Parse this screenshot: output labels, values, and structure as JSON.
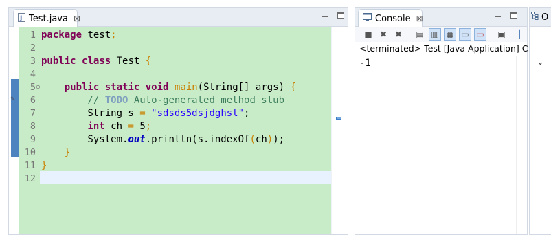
{
  "editor": {
    "tab": {
      "label": "Test.java",
      "close": "⊠"
    },
    "lines": [
      {
        "num": "1",
        "tokens": [
          {
            "t": "package",
            "c": "kw"
          },
          {
            "t": " test",
            "c": ""
          },
          {
            "t": ";",
            "c": "brk"
          }
        ]
      },
      {
        "num": "2",
        "tokens": []
      },
      {
        "num": "3",
        "tokens": [
          {
            "t": "public",
            "c": "kw"
          },
          {
            "t": " ",
            "c": ""
          },
          {
            "t": "class",
            "c": "kw"
          },
          {
            "t": " Test ",
            "c": ""
          },
          {
            "t": "{",
            "c": "brk"
          }
        ]
      },
      {
        "num": "4",
        "tokens": []
      },
      {
        "num": "5",
        "fold": "⊖",
        "tokens": [
          {
            "t": "    ",
            "c": ""
          },
          {
            "t": "public",
            "c": "kw"
          },
          {
            "t": " ",
            "c": ""
          },
          {
            "t": "static",
            "c": "kw"
          },
          {
            "t": " ",
            "c": ""
          },
          {
            "t": "void",
            "c": "kw"
          },
          {
            "t": " ",
            "c": ""
          },
          {
            "t": "main",
            "c": "brk"
          },
          {
            "t": "(String[] args) ",
            "c": ""
          },
          {
            "t": "{",
            "c": "brk"
          }
        ]
      },
      {
        "num": "6",
        "tokens": [
          {
            "t": "        // ",
            "c": "cmt"
          },
          {
            "t": "TODO",
            "c": "todo"
          },
          {
            "t": " Auto-generated method stub",
            "c": "cmt"
          }
        ]
      },
      {
        "num": "7",
        "tokens": [
          {
            "t": "        String s ",
            "c": ""
          },
          {
            "t": "=",
            "c": "brk"
          },
          {
            "t": " ",
            "c": ""
          },
          {
            "t": "\"sdsds5dsjdghsl\"",
            "c": "str"
          },
          {
            "t": ";",
            "c": ""
          }
        ]
      },
      {
        "num": "8",
        "tokens": [
          {
            "t": "        ",
            "c": ""
          },
          {
            "t": "int",
            "c": "kw"
          },
          {
            "t": " ch ",
            "c": ""
          },
          {
            "t": "=",
            "c": "brk"
          },
          {
            "t": " 5",
            "c": ""
          },
          {
            "t": ";",
            "c": "brk"
          }
        ]
      },
      {
        "num": "9",
        "tokens": [
          {
            "t": "        System.",
            "c": ""
          },
          {
            "t": "out",
            "c": "fld"
          },
          {
            "t": ".println(s.indexOf",
            "c": ""
          },
          {
            "t": "(",
            "c": "brk"
          },
          {
            "t": "ch",
            "c": ""
          },
          {
            "t": ")",
            "c": "brk"
          },
          {
            "t": ");",
            "c": ""
          }
        ]
      },
      {
        "num": "10",
        "tokens": [
          {
            "t": "    ",
            "c": ""
          },
          {
            "t": "}",
            "c": "brk"
          }
        ]
      },
      {
        "num": "11",
        "tokens": [
          {
            "t": "}",
            "c": "brk"
          }
        ]
      },
      {
        "num": "12",
        "tokens": []
      }
    ]
  },
  "console": {
    "tab": {
      "label": "Console",
      "close": "⊠"
    },
    "status": "<terminated> Test [Java Application] C:\\P",
    "output": "-1",
    "toolbar": [
      "stop-icon",
      "remove-launch-icon",
      "remove-all-icon",
      "clear-console-icon",
      "scroll-lock-icon",
      "word-wrap-icon",
      "show-stdout-icon",
      "show-stderr-icon",
      "pin-console-icon",
      "open-console-icon"
    ]
  },
  "outline": {
    "tab": {
      "label": "O"
    }
  },
  "colors": {
    "editor_bg": "#c8ecc8",
    "current_line": "#e8f2fe",
    "keyword": "#7f0055",
    "comment": "#3f7f5f",
    "string": "#2a00ff"
  }
}
